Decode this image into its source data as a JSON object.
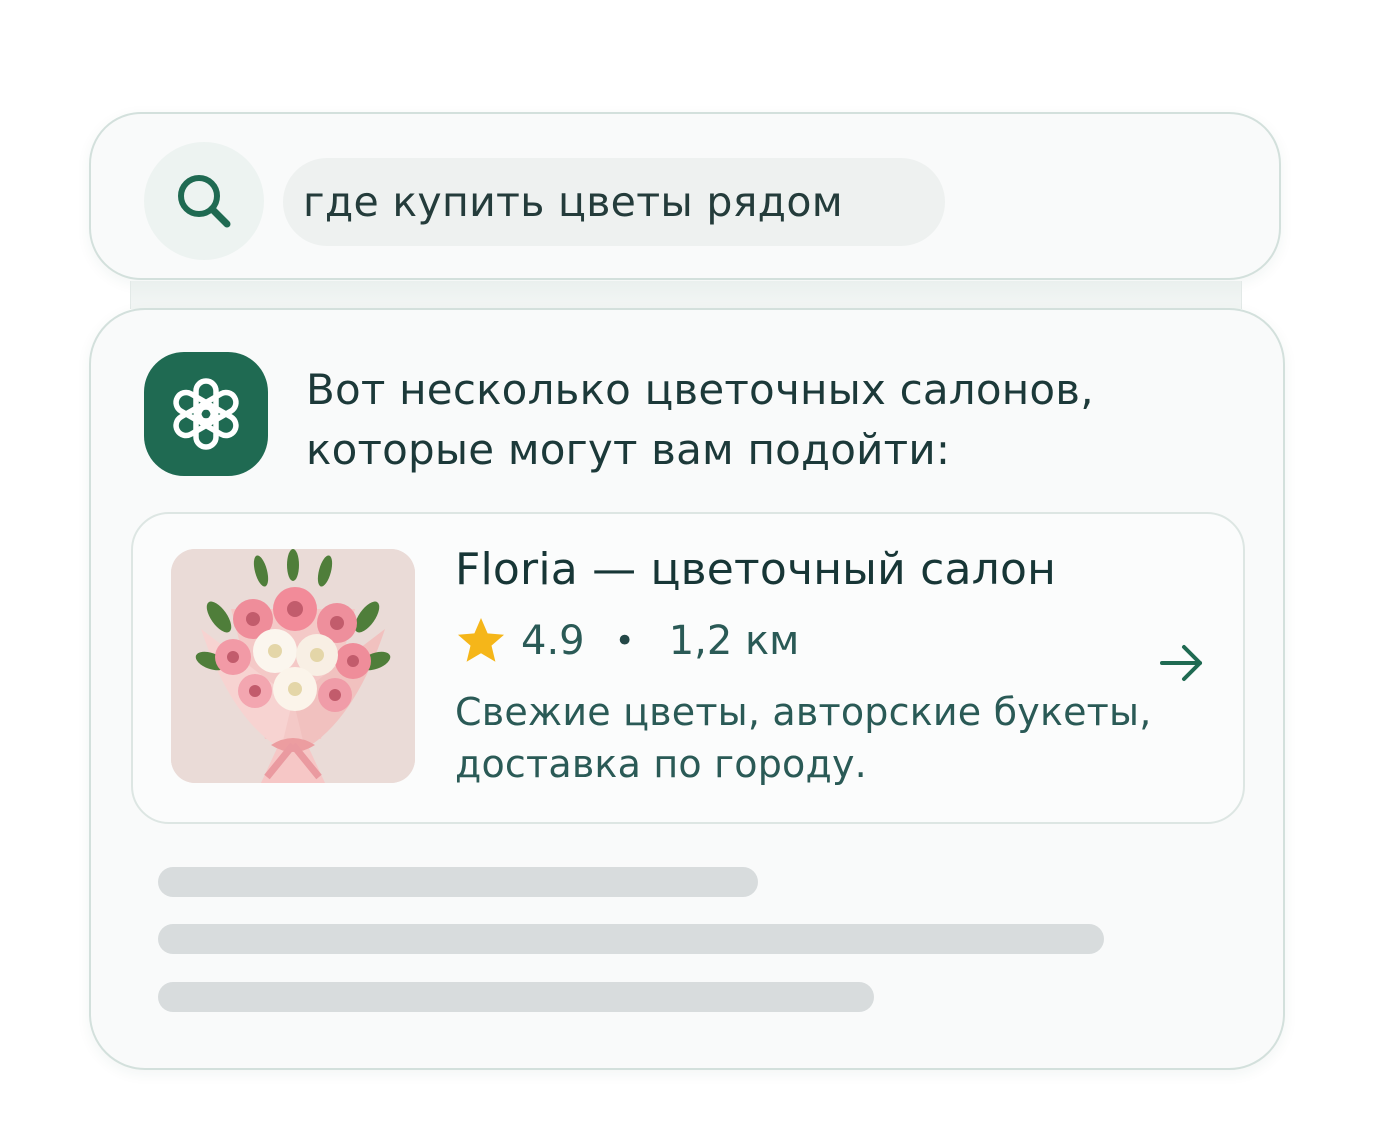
{
  "search": {
    "query": "где купить цветы рядом",
    "icon": "search-icon"
  },
  "assistant": {
    "icon": "assistant-logo-icon",
    "message_line1": "Вот несколько цветочных салонов,",
    "message_line2": "которые могут вам подойти:"
  },
  "result": {
    "title": "Floria — цветочный салон",
    "rating": "4.9",
    "separator": "•",
    "distance": "1,2 км",
    "description_line1": "Свежие цветы, авторские букеты,",
    "description_line2": "доставка по городу.",
    "image": "bouquet-image",
    "action_icon": "arrow-right-icon"
  },
  "placeholder_lines": 3,
  "colors": {
    "accent": "#1f6a52",
    "star": "#f5b619",
    "border": "#d3e0dc",
    "skeleton": "#d8dcdd",
    "text_dark": "#173636",
    "text_muted": "#2a5a56"
  }
}
